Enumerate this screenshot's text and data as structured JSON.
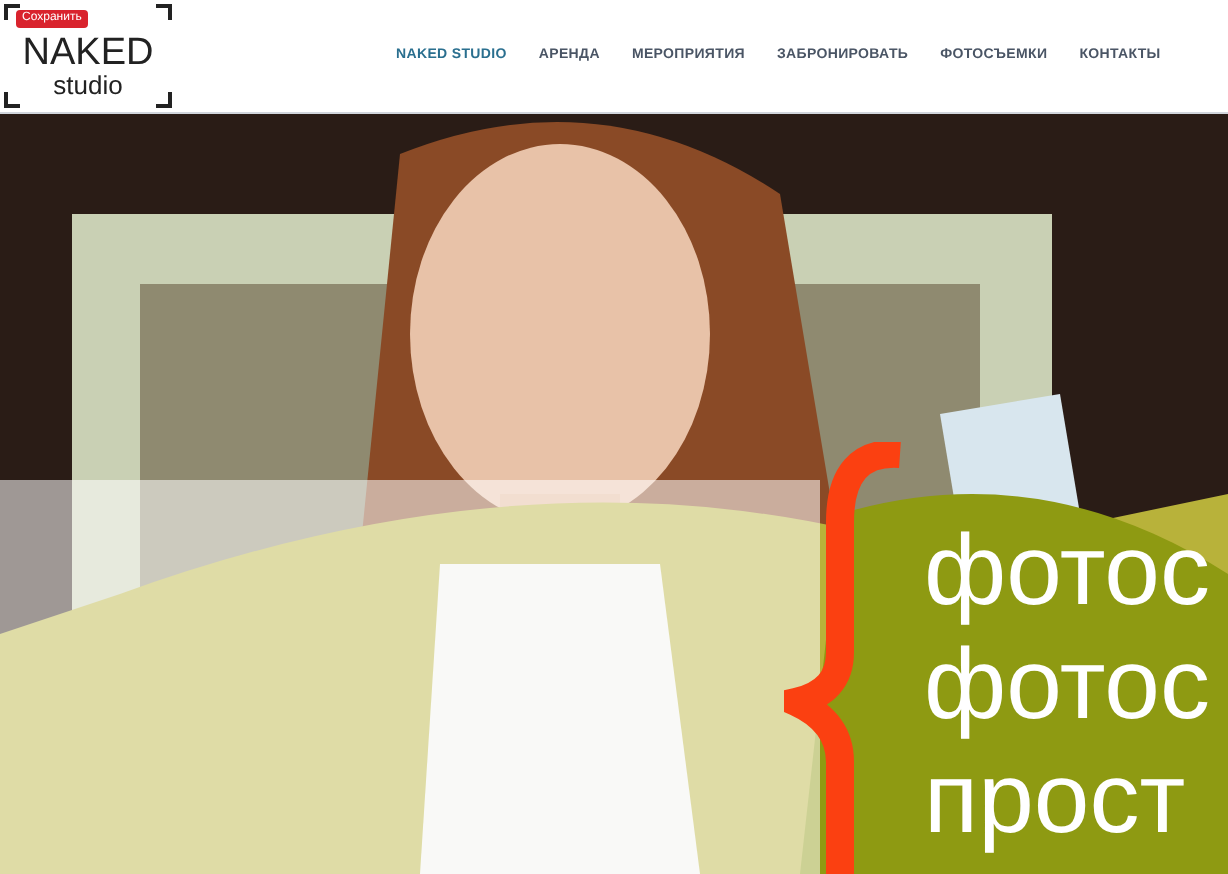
{
  "header": {
    "logo": {
      "title": "NAKED",
      "subtitle": "studio"
    },
    "save_badge": "Сохранить",
    "nav": [
      {
        "label": "NAKED STUDIO",
        "selected": true
      },
      {
        "label": "АРЕНДА",
        "selected": false
      },
      {
        "label": "МЕРОПРИЯТИЯ",
        "selected": false
      },
      {
        "label": "ЗАБРОНИРОВАТЬ",
        "selected": false
      },
      {
        "label": "ФОТОСЪЕМКИ",
        "selected": false
      },
      {
        "label": "КОНТАКТЫ",
        "selected": false
      }
    ]
  },
  "hero": {
    "headline": [
      "фотос",
      "фотос",
      "прост"
    ]
  }
}
